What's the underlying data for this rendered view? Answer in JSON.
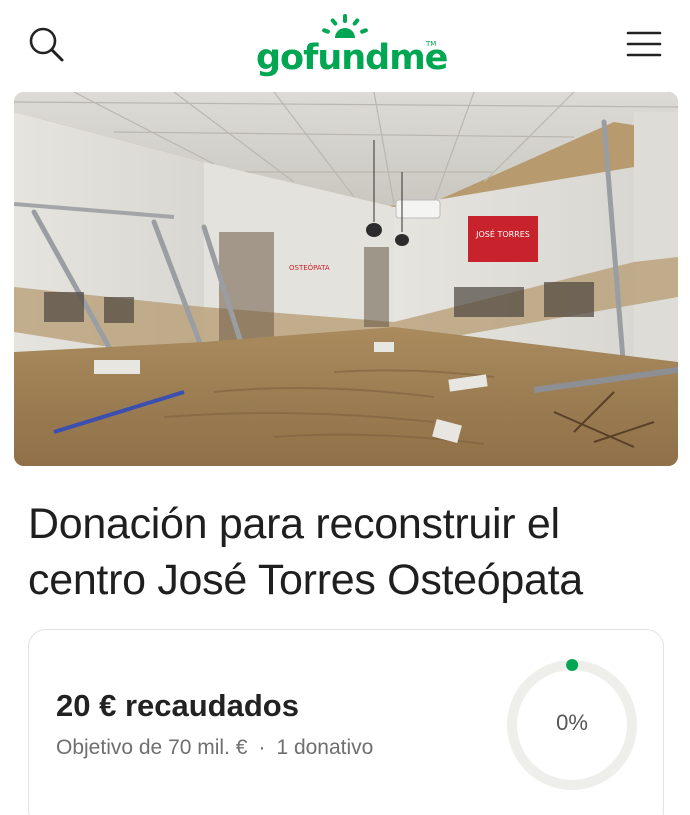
{
  "header": {
    "logo_text": "gofundme",
    "logo_tm": "TM",
    "search_icon": "search-icon",
    "menu_icon": "hamburger-menu-icon",
    "brand_color": "#00a651"
  },
  "hero": {
    "photo_sign_1": "JOSÉ TORRES",
    "photo_sign_2": "OSTEÓPATA"
  },
  "campaign": {
    "title_line1": "Donación para reconstruir el",
    "title_line2": "centro José Torres Osteópata"
  },
  "progress": {
    "raised_text": "20 € recaudados",
    "goal_text": "Objetivo de 70 mil. €",
    "separator": "·",
    "donations_text": "1 donativo",
    "percent_text": "0%",
    "percent_value": 0.0003,
    "ring_track_color": "#eeeeea",
    "ring_fill_color": "#00a651"
  }
}
